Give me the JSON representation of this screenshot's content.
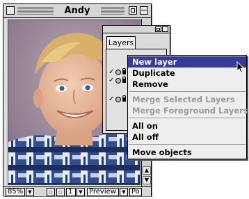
{
  "image_window": {
    "title": "Andy",
    "status": {
      "zoom": "85%",
      "page": "1",
      "mode": "Preview",
      "extra": "Po"
    }
  },
  "layers_palette": {
    "tab_label": "Layers",
    "rows": [
      {
        "checked": "✓"
      },
      {
        "checked": "✓"
      },
      {
        "checked": "✓"
      }
    ]
  },
  "context_menu": {
    "items": [
      {
        "label": "New layer",
        "state": "highlighted"
      },
      {
        "label": "Duplicate",
        "state": "enabled"
      },
      {
        "label": "Remove",
        "state": "enabled"
      },
      {
        "label": "Merge Selected Layers",
        "state": "disabled"
      },
      {
        "label": "Merge Foreground Layers",
        "state": "disabled"
      },
      {
        "label": "All on",
        "state": "enabled"
      },
      {
        "label": "All off",
        "state": "enabled"
      },
      {
        "label": "Move objects",
        "state": "enabled"
      }
    ]
  },
  "colors": {
    "highlight": "#3a3a9a",
    "disabled_text": "#9a9a9a",
    "window_chrome": "#dddddd"
  },
  "icons": [
    "close-box-icon",
    "zoom-box-icon",
    "collapse-box-icon",
    "checkmark-icon",
    "eye-icon",
    "lock-icon",
    "arrow-cursor-icon",
    "scroll-arrow-up-icon",
    "scroll-arrow-down-icon"
  ]
}
